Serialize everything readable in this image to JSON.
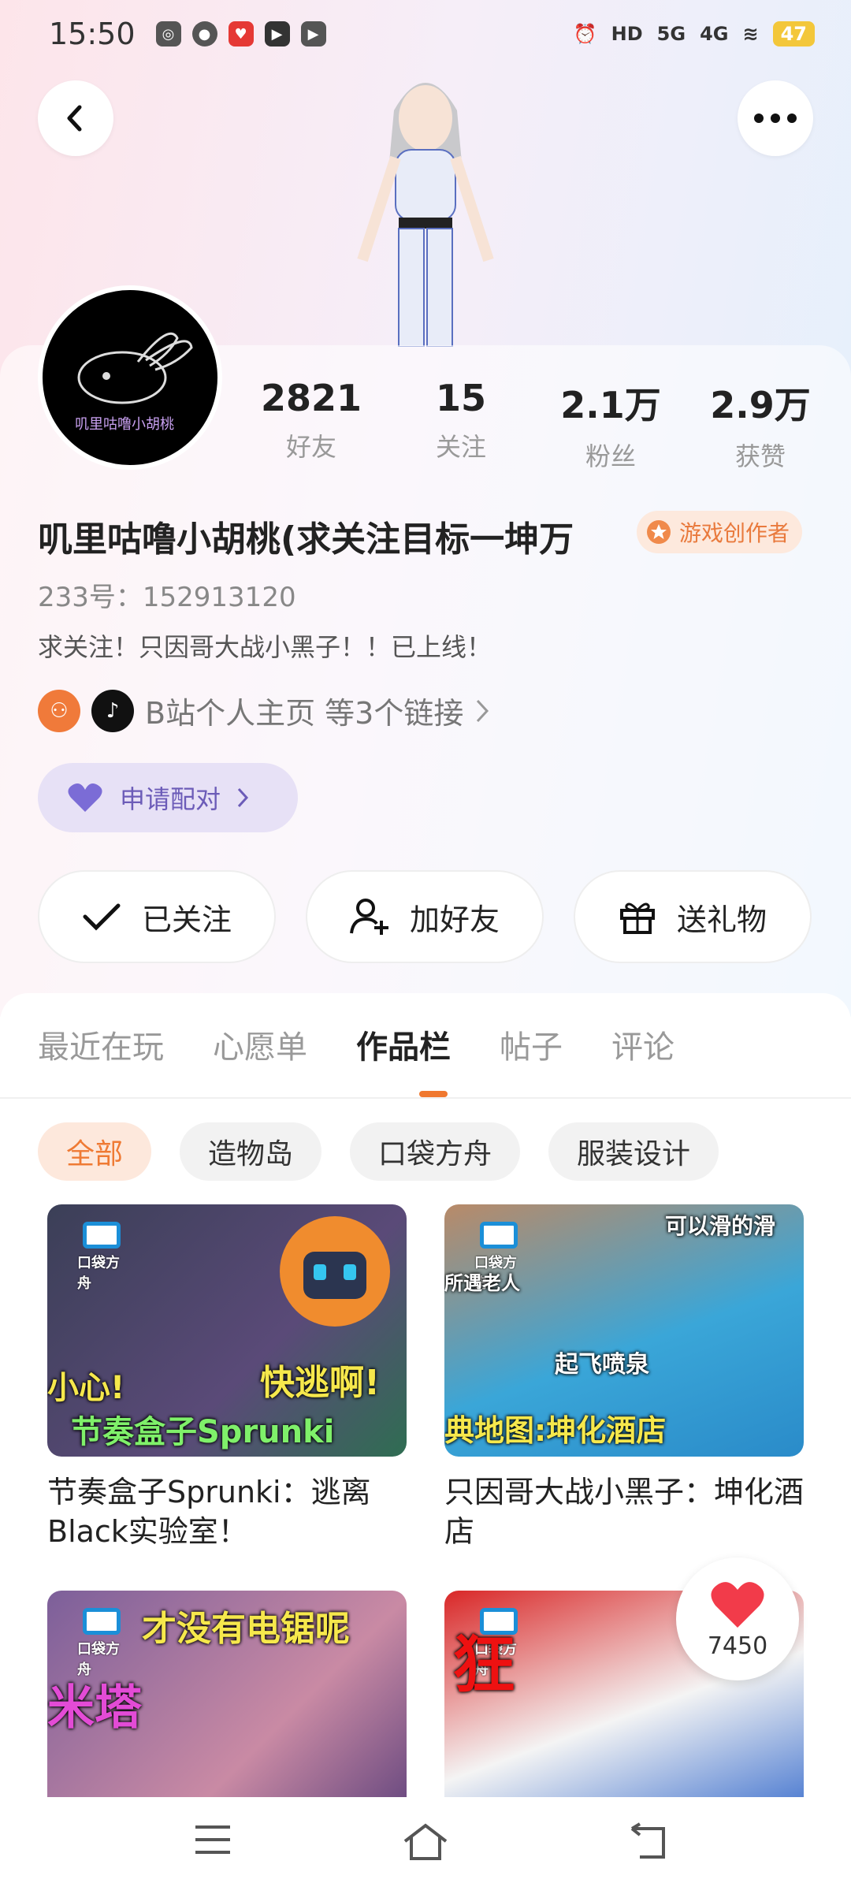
{
  "status": {
    "time": "15:50",
    "battery": "47",
    "hd": "HD",
    "net1": "5G",
    "net2": "4G"
  },
  "profile": {
    "stats": [
      {
        "num": "2821",
        "label": "好友"
      },
      {
        "num": "15",
        "label": "关注"
      },
      {
        "num": "2.1万",
        "label": "粉丝"
      },
      {
        "num": "2.9万",
        "label": "获赞"
      }
    ],
    "name": "叽里咕噜小胡桃(求关注目标一坤万",
    "badge": "游戏创作者",
    "uid": "233号：152913120",
    "bio": "求关注！只因哥大战小黑子！！已上线！",
    "links_text": "B站个人主页 等3个链接",
    "pair_label": "申请配对"
  },
  "actions": {
    "follow": "已关注",
    "add_friend": "加好友",
    "gift": "送礼物"
  },
  "tabs": [
    "最近在玩",
    "心愿单",
    "作品栏",
    "帖子",
    "评论"
  ],
  "active_tab": "作品栏",
  "chips": [
    "全部",
    "造物岛",
    "口袋方舟",
    "服装设计"
  ],
  "works": [
    {
      "title": "节奏盒子Sprunki：逃离Black实验室！",
      "thumb_texts": [
        "小心!",
        "快逃啊!",
        "节奏盒子Sprunki"
      ],
      "brand": "口袋方舟"
    },
    {
      "title": "只因哥大战小黑子：坤化酒店",
      "thumb_texts": [
        "可以滑的滑",
        "所遇老人",
        "起飞喷泉",
        "典地图:坤化酒店"
      ],
      "brand": "口袋方舟"
    },
    {
      "title": "",
      "thumb_texts": [
        "才没有电锯呢",
        "米塔"
      ],
      "brand": "口袋方舟"
    },
    {
      "title": "",
      "thumb_texts": [
        "狂"
      ],
      "brand": "口袋方舟"
    }
  ],
  "like_count": "7450",
  "avatar_text": "叽里咕噜小胡桃",
  "colors": {
    "accent": "#f0782f",
    "pair": "#6c5cb8",
    "badge": "#e97a3d"
  }
}
